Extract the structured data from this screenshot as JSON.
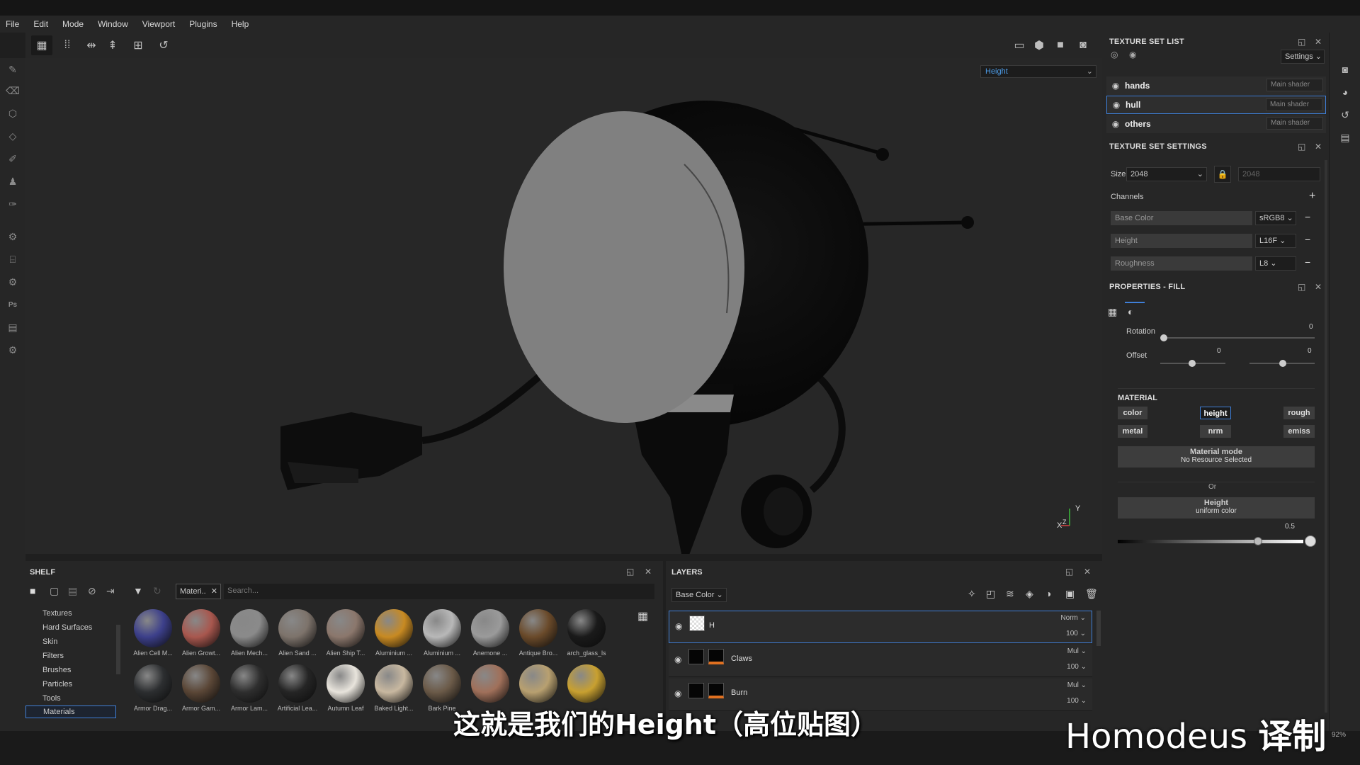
{
  "menu": [
    "File",
    "Edit",
    "Mode",
    "Window",
    "Viewport",
    "Plugins",
    "Help"
  ],
  "viewport": {
    "channel_select": "Height",
    "axis_y": "Y",
    "axis_x": "X",
    "axis_z": "Z"
  },
  "texture_set_list": {
    "title": "TEXTURE SET LIST",
    "settings_label": "Settings",
    "items": [
      {
        "name": "hands",
        "shader": "Main shader"
      },
      {
        "name": "hull",
        "shader": "Main shader",
        "selected": true
      },
      {
        "name": "others",
        "shader": "Main shader"
      }
    ]
  },
  "texture_set_settings": {
    "title": "TEXTURE SET SETTINGS",
    "size_label": "Size",
    "size_value": "2048",
    "size_linked": "2048",
    "channels_label": "Channels",
    "channels": [
      {
        "name": "Base Color",
        "format": "sRGB8"
      },
      {
        "name": "Height",
        "format": "L16F"
      },
      {
        "name": "Roughness",
        "format": "L8"
      }
    ]
  },
  "properties_fill": {
    "title": "PROPERTIES - FILL",
    "rotation_label": "Rotation",
    "rotation_value": "0",
    "offset_label": "Offset",
    "offset_x": "0",
    "offset_y": "0",
    "material_label": "MATERIAL",
    "material_buttons": [
      "color",
      "height",
      "rough",
      "metal",
      "nrm",
      "emiss"
    ],
    "material_mode_title": "Material mode",
    "material_mode_sub": "No Resource Selected",
    "or_label": "Or",
    "height_title": "Height",
    "height_sub": "uniform color",
    "height_value": "0.5"
  },
  "shelf": {
    "title": "SHELF",
    "filter_tag": "Materi..",
    "search_placeholder": "Search...",
    "categories": [
      "Textures",
      "Hard Surfaces",
      "Skin",
      "Filters",
      "Brushes",
      "Particles",
      "Tools",
      "Materials"
    ],
    "selected_category": "Materials",
    "materials": [
      {
        "name": "Alien Cell M...",
        "color": "#3c3f8a"
      },
      {
        "name": "Alien Growt...",
        "color": "#a8574e"
      },
      {
        "name": "Alien Mech...",
        "color": "#8a8a8a"
      },
      {
        "name": "Alien Sand ...",
        "color": "#7d736b"
      },
      {
        "name": "Alien Ship T...",
        "color": "#8b776c"
      },
      {
        "name": "Aluminium ...",
        "color": "#c88a22"
      },
      {
        "name": "Aluminium ...",
        "color": "#b8b8b8"
      },
      {
        "name": "Anemone ...",
        "color": "#9a9a9a"
      },
      {
        "name": "Antique Bro...",
        "color": "#6a4a2a"
      },
      {
        "name": "arch_glass_ls",
        "color": "#1a1a1a"
      },
      {
        "name": "Armor Drag...",
        "color": "#2c2e30"
      },
      {
        "name": "Armor Gam...",
        "color": "#5a4636"
      },
      {
        "name": "Armor Lam...",
        "color": "#2e2e2e"
      },
      {
        "name": "Artificial Lea...",
        "color": "#252525"
      },
      {
        "name": "Autumn Leaf",
        "color": "#e8e4dc"
      },
      {
        "name": "Baked Light...",
        "color": "#c8b8a0"
      },
      {
        "name": "Bark Pine",
        "color": "#6b5a48"
      },
      {
        "name": "",
        "color": "#a0705a"
      },
      {
        "name": "",
        "color": "#b8a070"
      },
      {
        "name": "",
        "color": "#c8a030"
      }
    ]
  },
  "layers": {
    "title": "LAYERS",
    "channel_select": "Base Color",
    "rows": [
      {
        "name": "H",
        "blend": "Norm",
        "opacity": "100"
      },
      {
        "name": "Claws",
        "blend": "Mul",
        "opacity": "100"
      },
      {
        "name": "Burn",
        "blend": "Mul",
        "opacity": "100"
      }
    ]
  },
  "status": {
    "zoom": "92%"
  },
  "subtitle": "这就是我们的Height（高位贴图）",
  "watermark": {
    "brand": "Homodeus",
    "tag": "译制"
  }
}
